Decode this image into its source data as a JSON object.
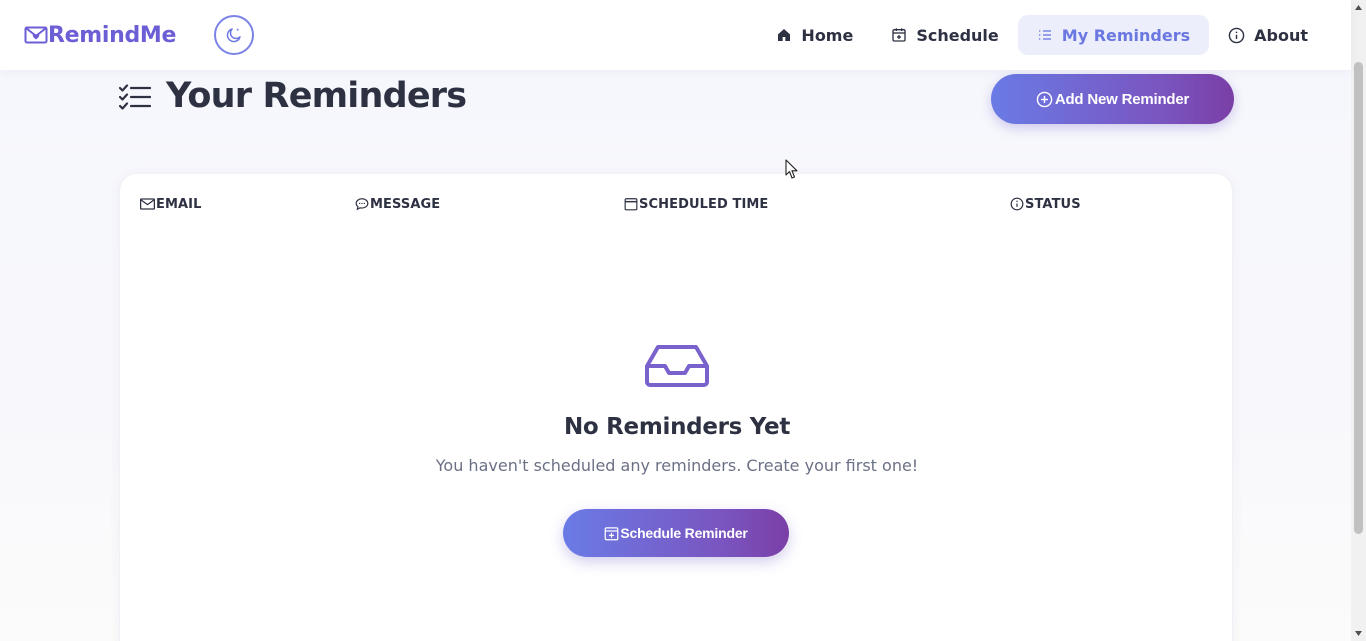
{
  "brand": {
    "name": "RemindMe",
    "accent": "#6c5fd6"
  },
  "nav": {
    "items": [
      {
        "label": "Home",
        "icon": "home-icon",
        "active": false
      },
      {
        "label": "Schedule",
        "icon": "calendar-plus-icon",
        "active": false
      },
      {
        "label": "My Reminders",
        "icon": "list-icon",
        "active": true
      },
      {
        "label": "About",
        "icon": "info-icon",
        "active": false
      }
    ],
    "theme_toggle_icon": "moon-icon"
  },
  "page": {
    "title": "Your Reminders",
    "title_icon": "checklist-icon",
    "add_button_label": "Add New Reminder"
  },
  "table": {
    "columns": [
      {
        "label": "EMAIL",
        "icon": "envelope-icon"
      },
      {
        "label": "MESSAGE",
        "icon": "chat-bubble-icon"
      },
      {
        "label": "SCHEDULED TIME",
        "icon": "calendar-icon"
      },
      {
        "label": "STATUS",
        "icon": "info-icon"
      }
    ],
    "rows": []
  },
  "empty_state": {
    "icon": "inbox-icon",
    "title": "No Reminders Yet",
    "text": "You haven't scheduled any reminders. Create your first one!",
    "button_label": "Schedule Reminder"
  },
  "colors": {
    "gradient_start": "#6a7be6",
    "gradient_end": "#7a3fa6",
    "nav_active_bg": "#eceefb",
    "nav_active_text": "#6b78e0"
  }
}
